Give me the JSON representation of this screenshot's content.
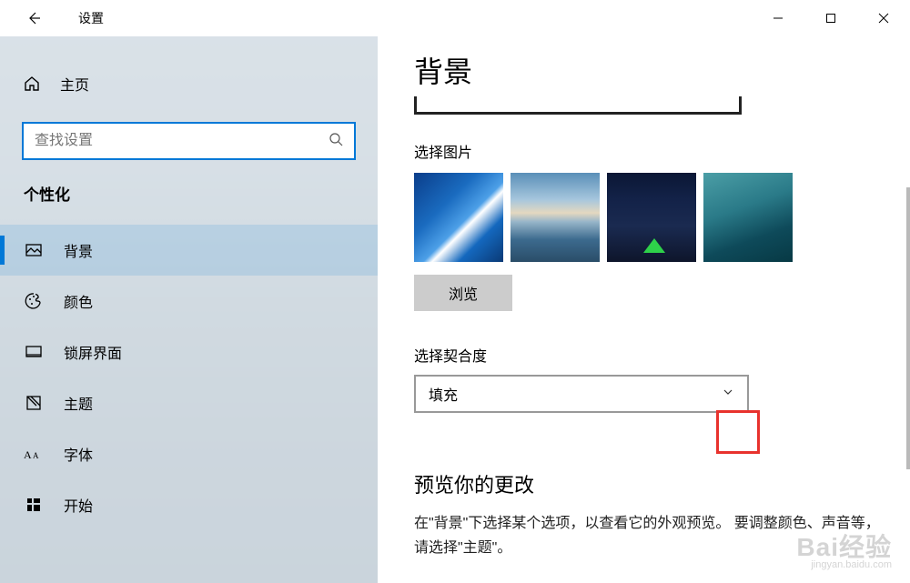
{
  "titlebar": {
    "title": "设置"
  },
  "sidebar": {
    "home": "主页",
    "search_placeholder": "查找设置",
    "category": "个性化",
    "items": [
      {
        "label": "背景"
      },
      {
        "label": "颜色"
      },
      {
        "label": "锁屏界面"
      },
      {
        "label": "主题"
      },
      {
        "label": "字体"
      },
      {
        "label": "开始"
      }
    ]
  },
  "content": {
    "heading": "背景",
    "choose_picture_label": "选择图片",
    "browse_label": "浏览",
    "choose_fit_label": "选择契合度",
    "fit_selected": "填充",
    "preview_heading": "预览你的更改",
    "preview_text": "在\"背景\"下选择某个选项，以查看它的外观预览。 要调整颜色、声音等，请选择\"主题\"。"
  },
  "watermark": {
    "brand": "Bai经验",
    "url": "jingyan.baidu.com"
  }
}
